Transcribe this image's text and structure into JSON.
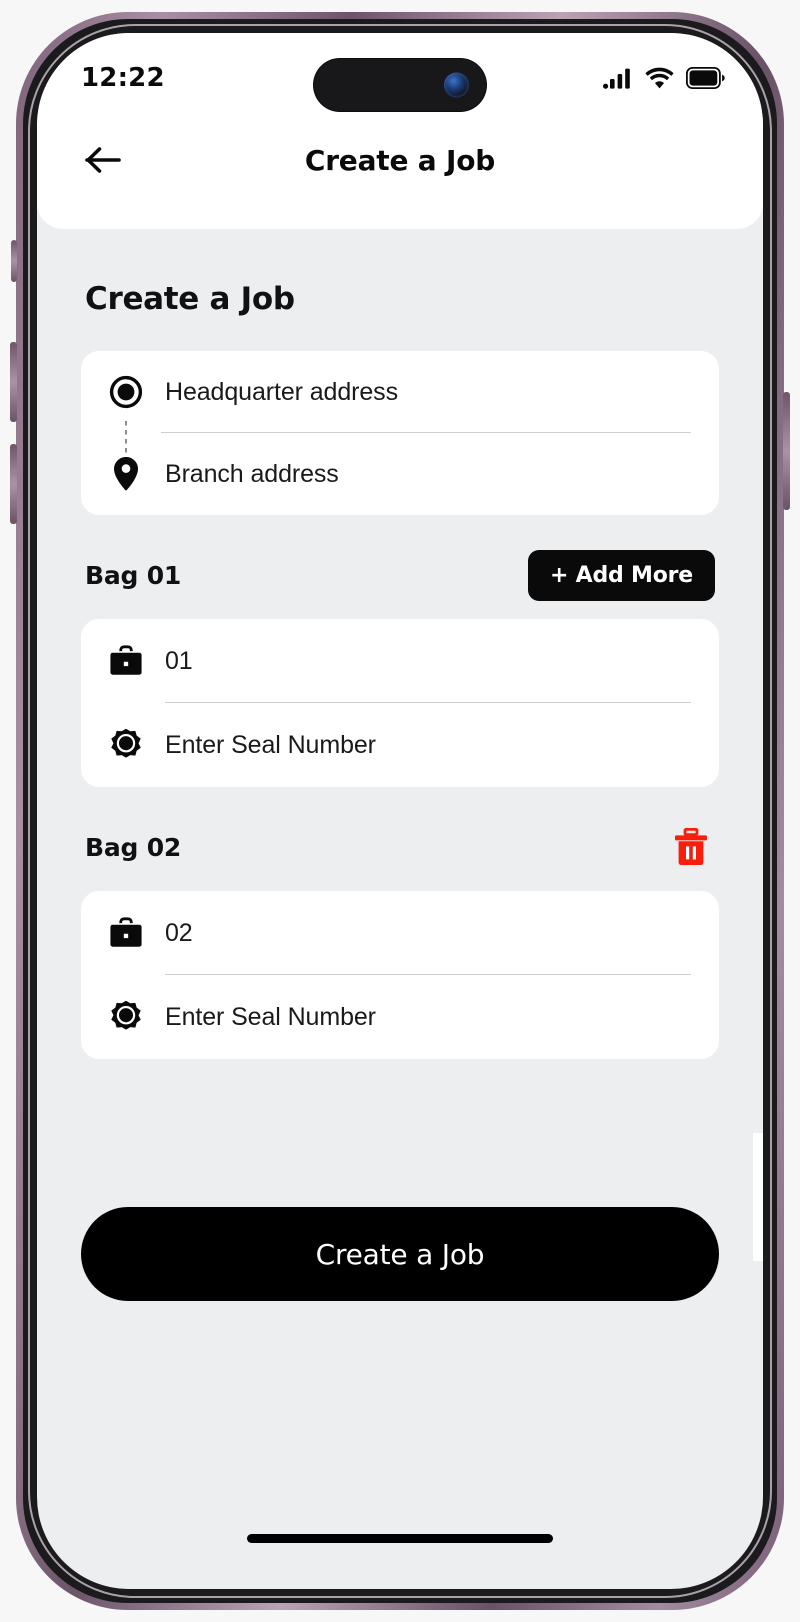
{
  "device": {
    "frame_color": "#7d6279",
    "bezel_color": "#1b1b1d",
    "screen_bg": "#eceef0"
  },
  "status_bar": {
    "time": "12:22",
    "cellular_icon": "cellular-signal-icon",
    "wifi_icon": "wifi-icon",
    "battery_icon": "battery-full-icon",
    "dynamic_island": "dynamic-island",
    "camera": "front-camera-lens"
  },
  "nav": {
    "back_icon": "arrow-left-icon",
    "title": "Create a Job"
  },
  "main": {
    "page_title": "Create a Job",
    "address_card": {
      "options": [
        {
          "label": "Headquarter address",
          "icon": "radio-selected-icon",
          "selected": true
        },
        {
          "label": "Branch address",
          "icon": "map-pin-icon",
          "selected": false
        }
      ]
    },
    "bags": [
      {
        "title": "Bag 01",
        "action_label": "+ Add More",
        "action_type": "add-more-button",
        "bag_number_icon": "briefcase-icon",
        "bag_number_value": "01",
        "seal_icon": "seal-badge-icon",
        "seal_placeholder": "Enter Seal Number",
        "seal_value": ""
      },
      {
        "title": "Bag 02",
        "action_label": "",
        "action_type": "delete-button",
        "delete_icon": "trash-icon",
        "delete_color": "#F81E0E",
        "bag_number_icon": "briefcase-icon",
        "bag_number_value": "02",
        "seal_icon": "seal-badge-icon",
        "seal_placeholder": "Enter Seal Number",
        "seal_value": ""
      }
    ],
    "cta": {
      "label": "Create a Job",
      "bg_color": "#000000",
      "text_color": "#FFFFFF"
    }
  },
  "system": {
    "home_indicator": "home-indicator"
  }
}
